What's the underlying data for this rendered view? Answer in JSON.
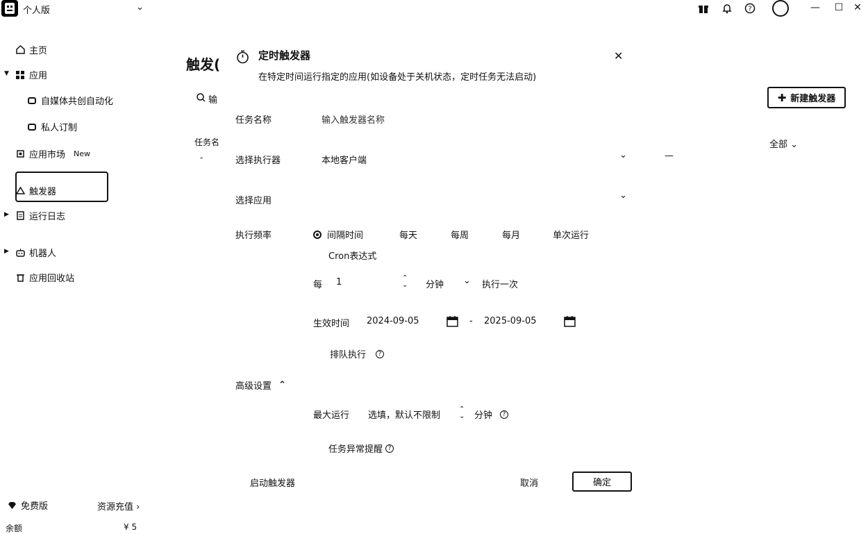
{
  "topbar": {
    "workspace": "个人版",
    "icons": [
      "gift-icon",
      "bell-icon",
      "help-icon",
      "avatar",
      "minimize-icon",
      "maximize-icon",
      "close-icon"
    ]
  },
  "sidebar": {
    "home": "主页",
    "apps": "应用",
    "app_items": [
      "自媒体共创自动化",
      "私人订制"
    ],
    "market": "应用市场",
    "market_badge": "New",
    "trigger": "触发器",
    "logs": "运行日志",
    "robot": "机器人",
    "recycle": "应用回收站",
    "plan": "免费版",
    "recharge": "资源充值",
    "balance_label": "余额",
    "balance_value": "¥ 5"
  },
  "background": {
    "page_title": "触发(",
    "search_placeholder": "输",
    "col_task": "任务名",
    "dash": "-",
    "new_trigger": "新建触发器",
    "filter_all": "全部",
    "line": "—"
  },
  "dialog": {
    "title": "定时触发器",
    "subtitle": "在特定时间运行指定的应用(如设备处于关机状态，定时任务无法启动)",
    "task_name_label": "任务名称",
    "task_name_placeholder": "输入触发器名称",
    "executor_label": "选择执行器",
    "executor_value": "本地客户端",
    "app_label": "选择应用",
    "freq_label": "执行频率",
    "freq_options": [
      "间隔时间",
      "每天",
      "每周",
      "每月",
      "单次运行"
    ],
    "cron_option": "Cron表达式",
    "every_label": "每",
    "every_value": "1",
    "unit_value": "分钟",
    "run_once": "执行一次",
    "effective_label": "生效时间",
    "start_date": "2024-09-05",
    "date_sep": "-",
    "end_date": "2025-09-05",
    "queue_label": "排队执行",
    "advanced_label": "高级设置",
    "max_run_label": "最大运行",
    "max_run_placeholder": "选填，默认不限制",
    "max_run_unit": "分钟",
    "alert_label": "任务异常提醒",
    "enable_label": "启动触发器",
    "cancel": "取消",
    "ok": "确定"
  }
}
